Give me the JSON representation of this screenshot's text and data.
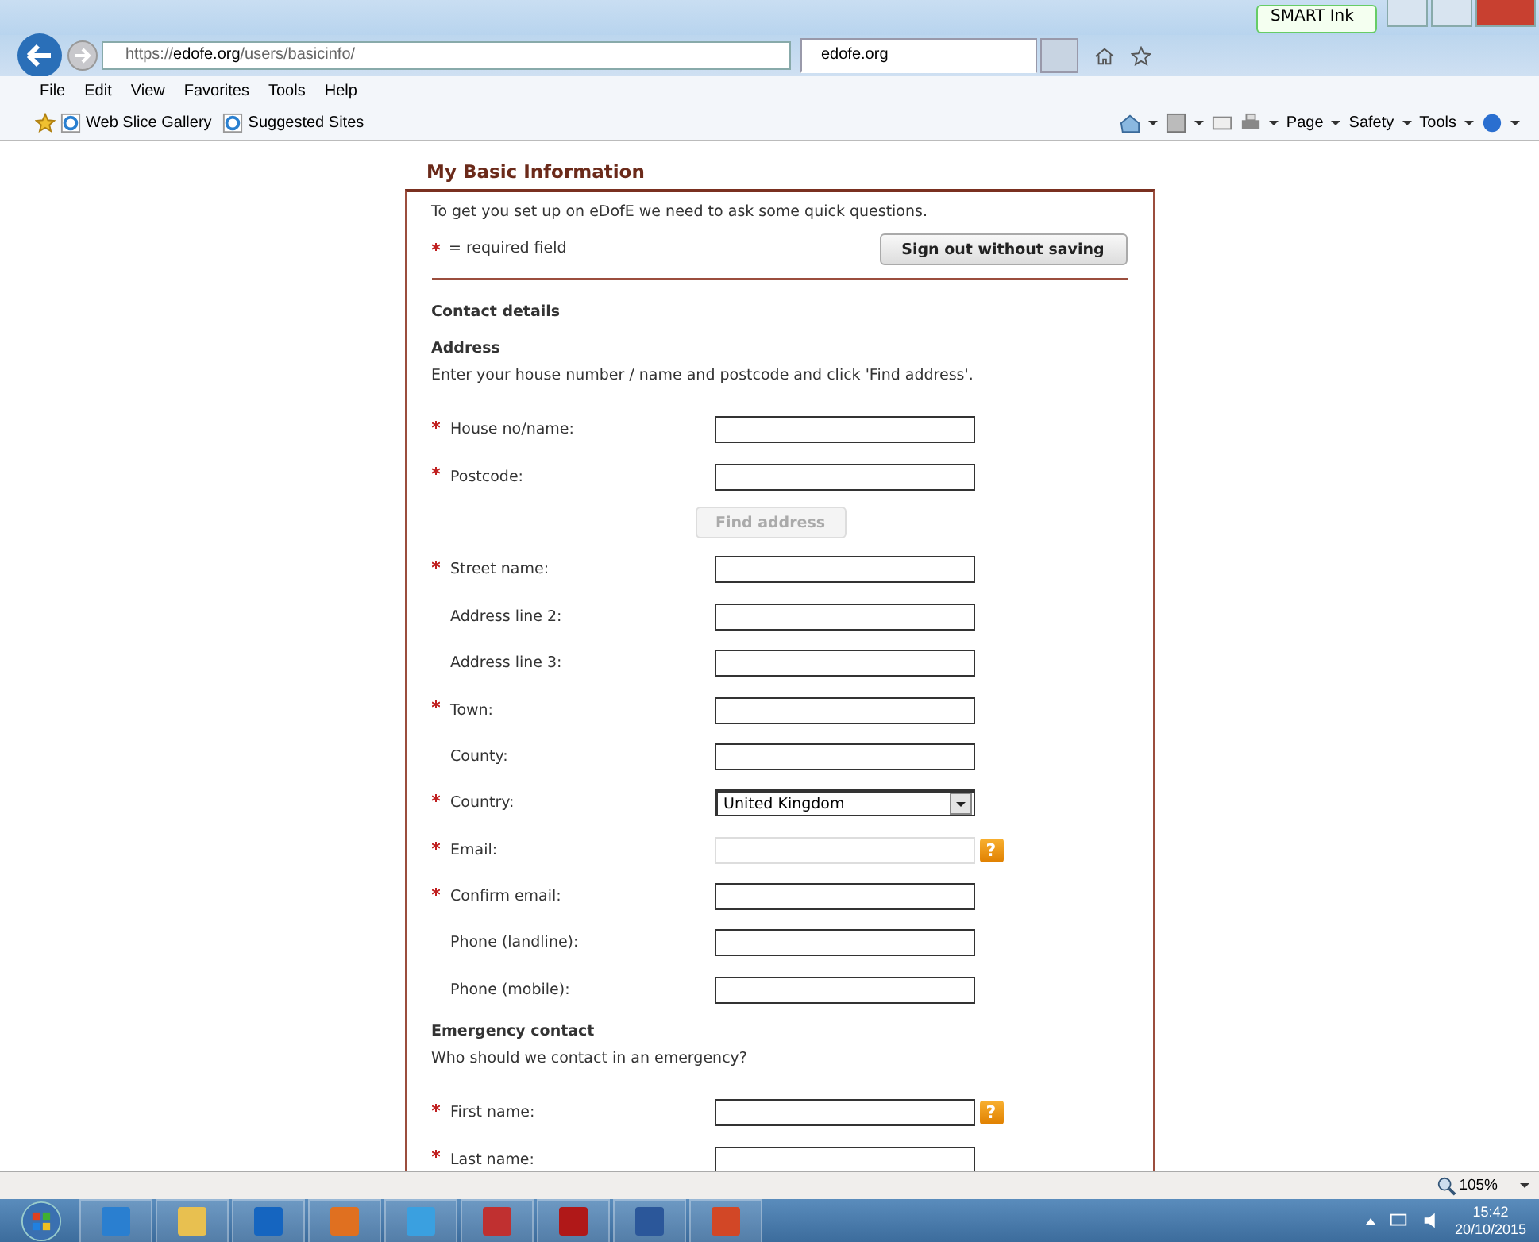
{
  "browser": {
    "url_scheme": "https://",
    "url_domain": "edofe.org",
    "url_path": "/users/basicinfo/",
    "tabs": [
      {
        "title": "edofe.org",
        "selected": true
      }
    ],
    "smart_ink": "SMART Ink",
    "menu": [
      "File",
      "Edit",
      "View",
      "Favorites",
      "Tools",
      "Help"
    ],
    "favorites": [
      "Web Slice Gallery",
      "Suggested Sites"
    ],
    "commands": [
      "Page",
      "Safety",
      "Tools"
    ]
  },
  "page": {
    "title": "My Basic Information",
    "intro": "To get you set up on eDofE we need to ask some quick questions.",
    "required_note": "= required field",
    "sign_out": "Sign out without saving",
    "items": [
      {
        "kind": "heading",
        "text": "Contact details"
      },
      {
        "kind": "heading",
        "text": "Address"
      },
      {
        "kind": "note",
        "text": "Enter your house number / name and postcode and click 'Find address'."
      },
      {
        "kind": "text",
        "label": "House no/name:",
        "required": true,
        "disabled": false
      },
      {
        "kind": "text",
        "label": "Postcode:",
        "required": true,
        "disabled": false
      },
      {
        "kind": "button",
        "text": "Find address",
        "disabled": true
      },
      {
        "kind": "text",
        "label": "Street name:",
        "required": true,
        "disabled": false
      },
      {
        "kind": "text",
        "label": "Address line 2:",
        "required": false,
        "disabled": false
      },
      {
        "kind": "text",
        "label": "Address line 3:",
        "required": false,
        "disabled": false
      },
      {
        "kind": "text",
        "label": "Town:",
        "required": true,
        "disabled": false
      },
      {
        "kind": "text",
        "label": "County:",
        "required": false,
        "disabled": false
      },
      {
        "kind": "select",
        "label": "Country:",
        "required": true,
        "value": "United Kingdom",
        "disabled": false
      },
      {
        "kind": "text",
        "label": "Email:",
        "required": true,
        "disabled": true,
        "help": "?"
      },
      {
        "kind": "text",
        "label": "Confirm email:",
        "required": true,
        "disabled": false
      },
      {
        "kind": "text",
        "label": "Phone (landline):",
        "required": false,
        "disabled": false
      },
      {
        "kind": "text",
        "label": "Phone (mobile):",
        "required": false,
        "disabled": false
      },
      {
        "kind": "heading",
        "text": "Emergency contact"
      },
      {
        "kind": "note",
        "text": "Who should we contact in an emergency?"
      },
      {
        "kind": "text",
        "label": "First name:",
        "required": true,
        "disabled": false,
        "help": "?"
      },
      {
        "kind": "text",
        "label": "Last name:",
        "required": true,
        "disabled": false
      }
    ]
  },
  "status_bar": {
    "zoom": "105%"
  },
  "taskbar": {
    "time": "15:42",
    "date": "20/10/2015"
  }
}
